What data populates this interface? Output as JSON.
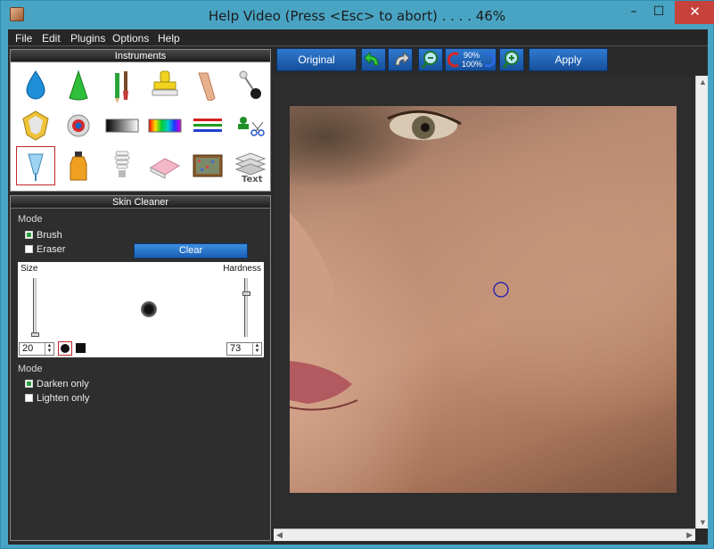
{
  "window": {
    "title": "Help Video (Press <Esc> to abort) . . . . 46%",
    "minimize_glyph": "–",
    "maximize_glyph": "☐",
    "close_glyph": "✕"
  },
  "menu": [
    "File",
    "Edit",
    "Plugins",
    "Options",
    "Help"
  ],
  "instruments": {
    "title": "Instruments",
    "tools": [
      "water-drop-icon",
      "cone-icon",
      "pencil-brush-icon",
      "stamp-icon",
      "finger-icon",
      "pin-icon",
      "diamond-shield-icon",
      "eye-icon",
      "gradient-bar-icon",
      "rainbow-bar-icon",
      "color-lines-icon",
      "scissors-icon",
      "funnel-icon",
      "bottle-icon",
      "light-bulb-icon",
      "eraser-icon",
      "tv-noise-icon",
      "text-layers-icon"
    ],
    "selected_index": 12
  },
  "skin_cleaner": {
    "title": "Skin Cleaner",
    "mode_label": "Mode",
    "brush_label": "Brush",
    "eraser_label": "Eraser",
    "brush_checked": true,
    "eraser_checked": false,
    "clear_label": "Clear",
    "size_label": "Size",
    "hardness_label": "Hardness",
    "size_value": "20",
    "hardness_value": "73",
    "mode2_label": "Mode",
    "darken_label": "Darken only",
    "lighten_label": "Lighten only",
    "darken_checked": true,
    "lighten_checked": false
  },
  "toolbar": {
    "original_label": "Original",
    "apply_label": "Apply",
    "zoom_top": "90%",
    "zoom_bottom": "100%"
  },
  "colors": {
    "title_bar": "#49a4c4",
    "close_button": "#c7423b",
    "button_blue": "#1f64b8",
    "selected_border": "#c0262b",
    "brush_cursor": "#1a1ab5"
  }
}
